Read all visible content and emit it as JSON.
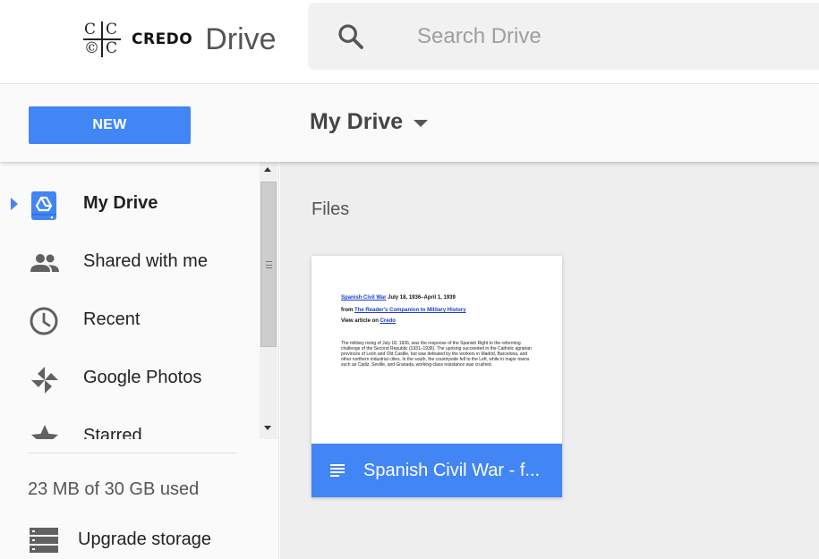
{
  "brand": {
    "logo_letters": [
      "C",
      "C",
      "©",
      "C"
    ],
    "credo": "CREDO",
    "drive": "Drive"
  },
  "search": {
    "placeholder": "Search Drive",
    "value": ""
  },
  "toolbar": {
    "new_label": "NEW",
    "title": "My Drive"
  },
  "sidebar": {
    "items": [
      {
        "label": "My Drive",
        "icon": "my-drive-icon",
        "active": true
      },
      {
        "label": "Shared with me",
        "icon": "shared-people-icon",
        "active": false
      },
      {
        "label": "Recent",
        "icon": "clock-icon",
        "active": false
      },
      {
        "label": "Google Photos",
        "icon": "pinwheel-icon",
        "active": false
      },
      {
        "label": "Starred",
        "icon": "star-icon",
        "active": false
      }
    ],
    "storage": "23 MB of 30 GB used",
    "upgrade_label": "Upgrade storage"
  },
  "main": {
    "section_heading": "Files",
    "files": [
      {
        "name": "Spanish Civil War - f...",
        "icon": "doc-lines-icon",
        "preview": {
          "title_link": "Spanish Civil War",
          "title_dates": " July 18, 1936–April 1, 1939",
          "from_prefix": "from ",
          "from_link": "The Reader's Companion to Military History",
          "view_prefix": "View article on ",
          "view_link": "Credo",
          "paragraph": "The military rising of July 18, 1936, was the response of the Spanish Right to the reforming challenge of the Second Republic (1931–1936). The uprising succeeded in the Catholic agrarian provinces of León and Old Castile, but was defeated by the workers in Madrid, Barcelona, and other northern industrial cities. In the south, the countryside fell to the Left, while in major towns such as Cádiz, Seville, and Granada, working-class resistance was crushed."
        }
      }
    ]
  },
  "colors": {
    "accent": "#4285f4",
    "sidebar_bg": "#fafafa",
    "main_bg": "#eeeeee"
  }
}
